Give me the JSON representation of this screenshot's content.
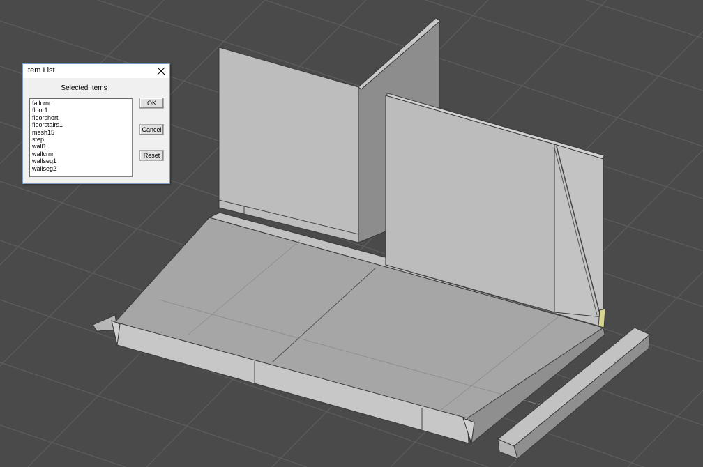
{
  "scene": {
    "background_color": "#4a4a4a",
    "grid_color": "#5e5e5e",
    "mesh_face_color": "#b4b4b4"
  },
  "item_list_dialog": {
    "title": "Item List",
    "close_icon": "close-icon",
    "caption": "Selected Items",
    "items": [
      "fallcrnr",
      "floor1",
      "floorshort",
      "floorstairs1",
      "mesh15",
      "step",
      "wall1",
      "wallcrnr",
      "wallseg1",
      "wallseg2"
    ],
    "ok_label": "OK",
    "cancel_label": "Cancel",
    "reset_label": "Reset"
  }
}
